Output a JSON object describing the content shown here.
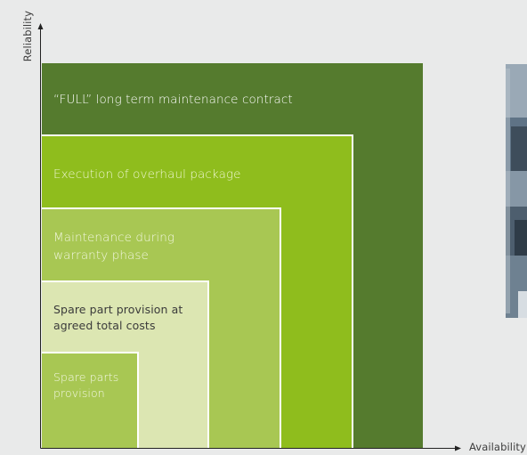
{
  "axes": {
    "y_label": "Reliability",
    "x_label": "Availability"
  },
  "levels": [
    {
      "label": "Spare parts provision",
      "color": "#a8c753"
    },
    {
      "label": "Spare part provision at agreed total costs",
      "color": "#dce6b2"
    },
    {
      "label": "Maintenance during warranty phase",
      "color": "#a8c753"
    },
    {
      "label": "Execution of overhaul package",
      "color": "#8fbd1d"
    },
    {
      "label": "“FULL” long term maintenance contract",
      "color": "#557b2e"
    }
  ],
  "photo": {
    "description_icon": "photo-icon"
  }
}
